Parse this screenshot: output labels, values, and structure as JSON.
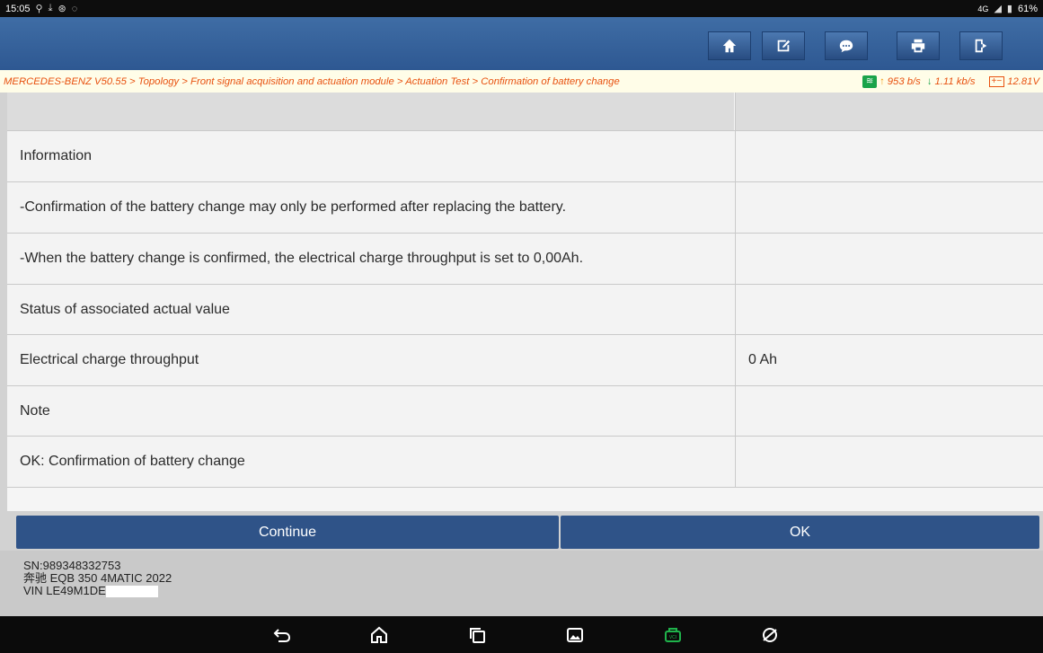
{
  "status_bar": {
    "time": "15:05",
    "left_icons": [
      "usb-icon",
      "download-icon",
      "settings-icon",
      "chat-icon"
    ],
    "network": "4G",
    "battery": "61%"
  },
  "toolbar": {
    "buttons": [
      {
        "name": "home-button",
        "icon": "home-icon"
      },
      {
        "name": "edit-button",
        "icon": "edit-icon"
      },
      {
        "name": "chat-button",
        "icon": "chat-bubble-icon"
      },
      {
        "name": "print-button",
        "icon": "printer-icon"
      },
      {
        "name": "exit-button",
        "icon": "exit-icon"
      }
    ]
  },
  "breadcrumb": {
    "path": "MERCEDES-BENZ V50.55 > Topology > Front signal acquisition and actuation module > Actuation Test > Confirmation of battery change",
    "upload_rate": "953 b/s",
    "download_rate": "1.11 kb/s",
    "voltage": "12.81V"
  },
  "table": {
    "rows": [
      {
        "label": "",
        "value": "",
        "header": true
      },
      {
        "label": "Information",
        "value": ""
      },
      {
        "label": " -Confirmation of the battery change may only be performed after replacing the battery.",
        "value": ""
      },
      {
        "label": " -When the battery change is confirmed, the electrical charge throughput is set to 0,00Ah.",
        "value": ""
      },
      {
        "label": "Status of associated actual value",
        "value": ""
      },
      {
        "label": "Electrical charge throughput",
        "value": "0 Ah"
      },
      {
        "label": "Note",
        "value": ""
      },
      {
        "label": "OK: Confirmation of battery change",
        "value": ""
      }
    ]
  },
  "actions": {
    "continue_label": "Continue",
    "ok_label": "OK"
  },
  "vehicle_info": {
    "sn": "SN:989348332753",
    "model": "奔驰 EQB 350 4MATIC 2022",
    "vin": "VIN LE49M1DE"
  },
  "colors": {
    "toolbar": "#2e5892",
    "button": "#2f5388",
    "breadcrumb_text": "#e8510f"
  }
}
